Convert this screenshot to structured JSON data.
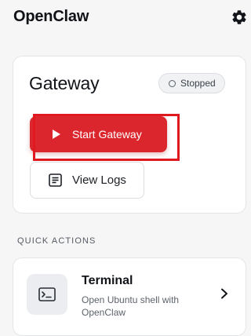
{
  "app": {
    "title": "OpenClaw",
    "settings_icon": "gear-icon"
  },
  "gateway": {
    "title": "Gateway",
    "status": "Stopped",
    "start_label": "Start Gateway",
    "logs_label": "View Logs",
    "accent_color": "#da262c"
  },
  "quick_actions": {
    "label": "QUICK ACTIONS",
    "items": [
      {
        "title": "Terminal",
        "description": "Open Ubuntu shell with OpenClaw",
        "icon": "terminal-icon"
      }
    ]
  }
}
